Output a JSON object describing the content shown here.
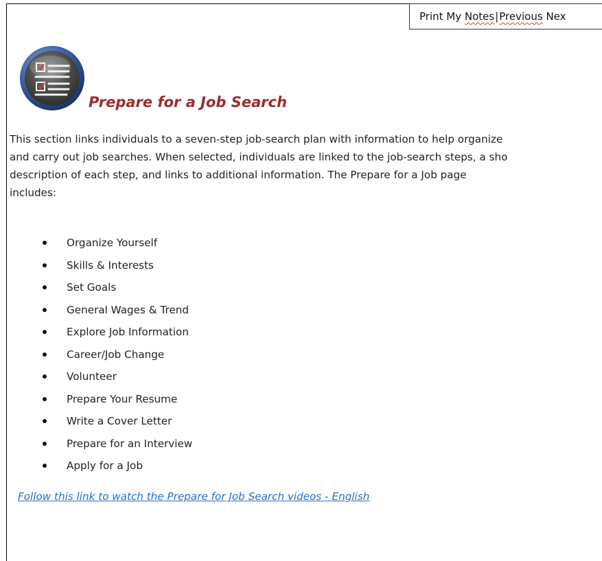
{
  "nav": {
    "print_label": "Print My",
    "notes_label": "Notes",
    "separator": "|",
    "previous_label": "Previous",
    "next_label": "Nex"
  },
  "section": {
    "icon": "checklist-icon",
    "title": "Prepare for a Job Search",
    "intro_lines": [
      "This section links individuals to a seven-step job-search plan with information to help organize",
      "and carry out job searches. When selected, individuals are linked to the job-search steps, a sho",
      "description of each step, and links to additional information. The Prepare for a Job page",
      "includes:"
    ],
    "steps": [
      "Organize Yourself",
      "Skills & Interests",
      "Set Goals",
      "General Wages & Trend",
      "Explore Job Information",
      "Career/Job Change",
      "Volunteer",
      "Prepare Your Resume",
      "Write a Cover Letter",
      "Prepare for an Interview",
      "Apply for a Job"
    ],
    "video_link": "Follow this link to watch the Prepare for Job Search videos - English"
  },
  "colors": {
    "title": "#9b2d2d",
    "link": "#2b6cc4",
    "icon_ring": "#3a5a9a"
  }
}
